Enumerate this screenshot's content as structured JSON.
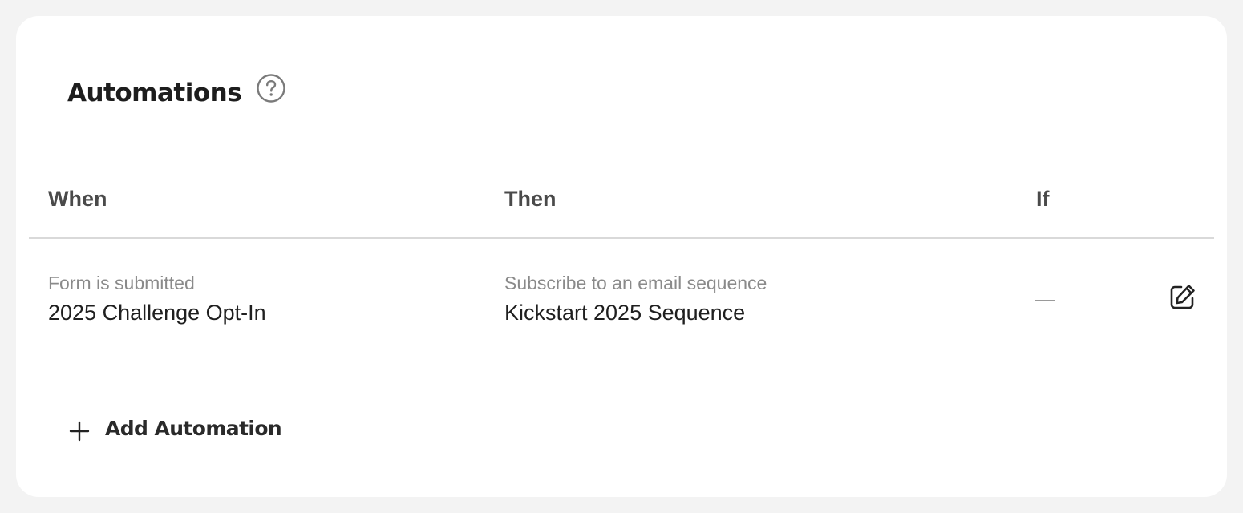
{
  "card": {
    "title": "Automations",
    "help_icon": "question-circle-icon"
  },
  "table": {
    "headers": {
      "when": "When",
      "then": "Then",
      "if": "If"
    },
    "rows": [
      {
        "when_sub": "Form is submitted",
        "when_main": "2025 Challenge Opt-In",
        "then_sub": "Subscribe to an email sequence",
        "then_main": "Kickstart 2025 Sequence",
        "if_value": "—",
        "edit_icon": "edit-pencil-icon"
      }
    ]
  },
  "add": {
    "label": "Add Automation",
    "icon": "plus-icon"
  }
}
